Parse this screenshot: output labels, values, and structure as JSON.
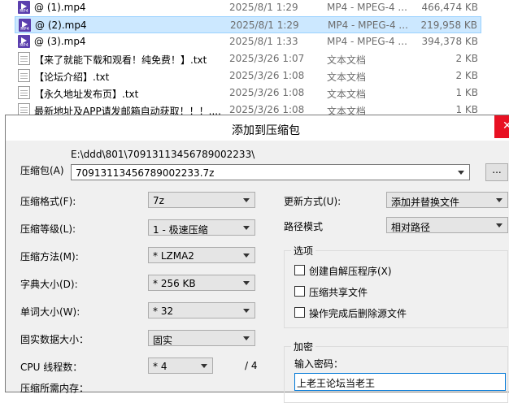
{
  "files": [
    {
      "name": "@ (1).mp4",
      "date": "2025/8/1 1:29",
      "type": "MP4 - MPEG-4 ...",
      "size": "466,474 KB",
      "icon": "mp4-video-icon",
      "selected": false
    },
    {
      "name": "@ (2).mp4",
      "date": "2025/8/1 1:29",
      "type": "MP4 - MPEG-4 ...",
      "size": "219,958 KB",
      "icon": "mp4-video-icon",
      "selected": true
    },
    {
      "name": "@ (3).mp4",
      "date": "2025/8/1 1:33",
      "type": "MP4 - MPEG-4 ...",
      "size": "394,378 KB",
      "icon": "mp4-video-icon",
      "selected": false
    },
    {
      "name": "【来了就能下载和观看！纯免费！】.txt",
      "date": "2025/3/26 1:07",
      "type": "文本文档",
      "size": "2 KB",
      "icon": "text-document-icon",
      "selected": false
    },
    {
      "name": "【论坛介绍】.txt",
      "date": "2025/3/26 1:08",
      "type": "文本文档",
      "size": "2 KB",
      "icon": "text-document-icon",
      "selected": false
    },
    {
      "name": "【永久地址发布页】.txt",
      "date": "2025/3/26 1:08",
      "type": "文本文档",
      "size": "1 KB",
      "icon": "text-document-icon",
      "selected": false
    },
    {
      "name": "最新地址及APP请发邮箱自动获取！！！....",
      "date": "2025/3/26 1:08",
      "type": "文本文档",
      "size": "1 KB",
      "icon": "text-document-icon",
      "selected": false
    }
  ],
  "dialog": {
    "title": "添加到压缩包",
    "archive_label": "压缩包(A)",
    "archive_path": "E:\\ddd\\801\\70913113456789002233\\",
    "archive_name": "70913113456789002233.7z",
    "browse_label": "...",
    "format_label": "压缩格式(F):",
    "format_value": "7z",
    "level_label": "压缩等级(L):",
    "level_value": "1 - 极速压缩",
    "method_label": "压缩方法(M):",
    "method_value": "* LZMA2",
    "dict_label": "字典大小(D):",
    "dict_value": "* 256 KB",
    "word_label": "单词大小(W):",
    "word_value": "* 32",
    "solid_label": "固实数据大小：",
    "solid_value": "固实",
    "cpu_label": "CPU 线程数：",
    "cpu_value": "* 4",
    "cpu_total": "/ 4",
    "memory_label": "压缩所需内存：",
    "update_label": "更新方式(U):",
    "update_value": "添加并替换文件",
    "path_label": "路径模式",
    "path_value": "相对路径",
    "options_title": "选项",
    "options": [
      {
        "label": "创建自解压程序(X)",
        "checked": false
      },
      {
        "label": "压缩共享文件",
        "checked": false
      },
      {
        "label": "操作完成后删除源文件",
        "checked": false
      }
    ],
    "encrypt_title": "加密",
    "password_label": "输入密码：",
    "password_value": "上老王论坛当老王",
    "close_icon": "close-icon"
  }
}
